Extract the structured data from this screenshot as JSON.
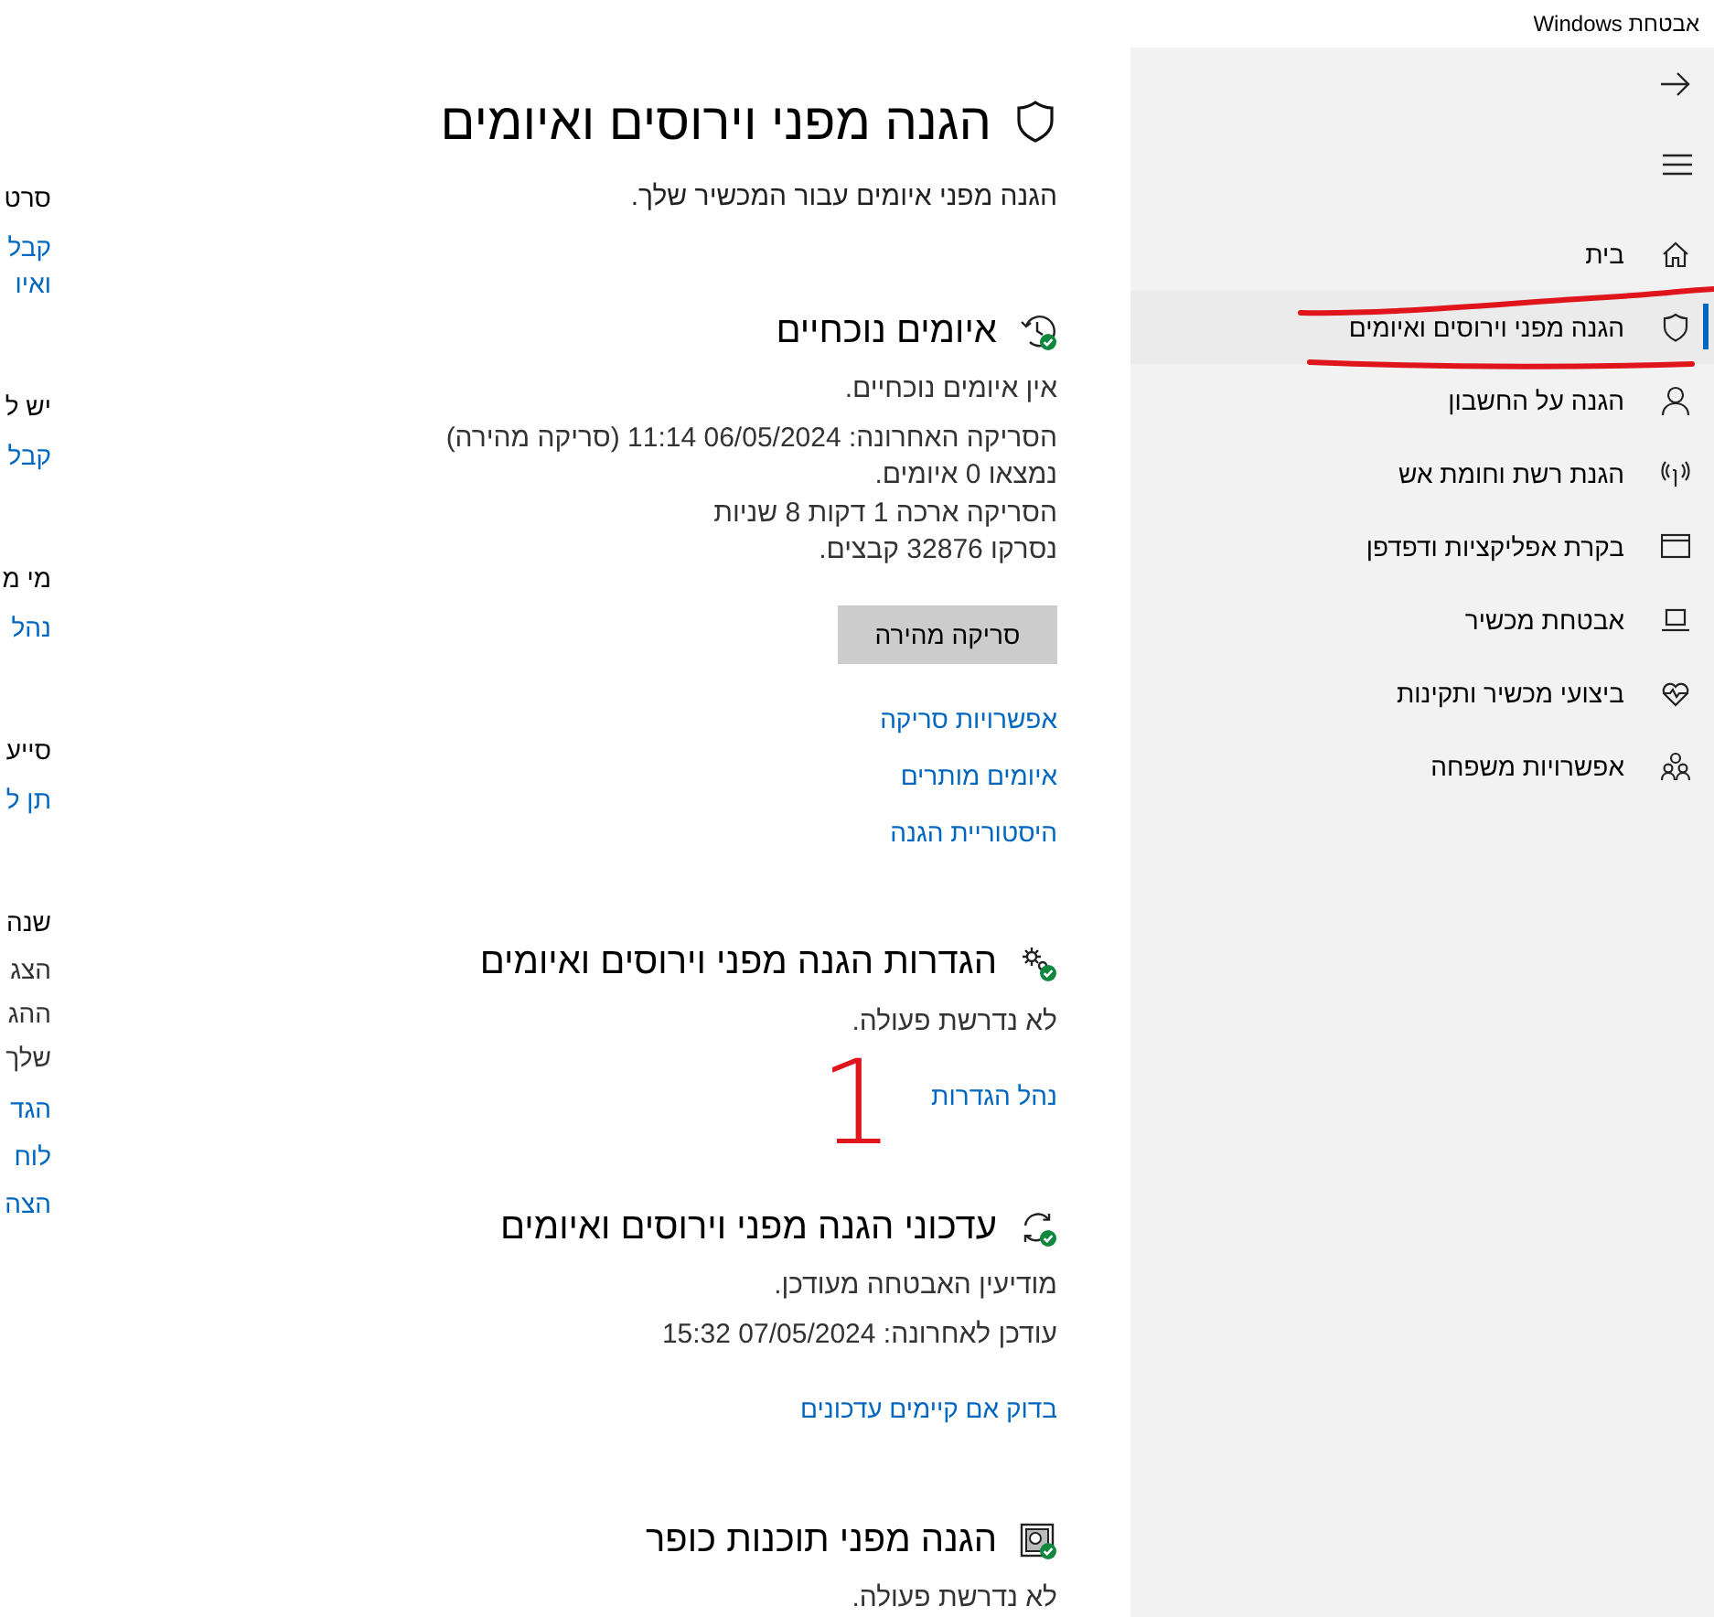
{
  "window": {
    "title": "אבטחת Windows"
  },
  "left_panel": [
    {
      "heading": "סרט",
      "links": [
        {
          "lines": [
            "קבל",
            "ואיו"
          ]
        }
      ]
    },
    {
      "heading": "יש ל",
      "links": [
        {
          "lines": [
            "קבל"
          ]
        }
      ]
    },
    {
      "heading": "מי מ",
      "links": [
        {
          "lines": [
            "נהל"
          ]
        }
      ]
    },
    {
      "heading": "סייע",
      "links": [
        {
          "lines": [
            "תן ל"
          ]
        }
      ]
    },
    {
      "heading": "שנה",
      "lines": [
        "הצג",
        "ההג",
        "שלך"
      ],
      "links": [
        {
          "lines": [
            "הגד"
          ]
        },
        {
          "lines": [
            "לוח"
          ]
        },
        {
          "lines": [
            "הצה"
          ]
        }
      ]
    }
  ],
  "page": {
    "title": "הגנה מפני וירוסים ואיומים",
    "subtitle": "הגנה מפני איומים עבור המכשיר שלך."
  },
  "sections": [
    {
      "heading": "איומים נוכחיים",
      "paragraphs": [
        [
          "אין איומים נוכחיים."
        ],
        [
          "הסריקה האחרונה: 06/05/2024 11:14 (סריקה מהירה)",
          "נמצאו 0 איומים.",
          "הסריקה ארכה 1 דקות 8 שניות",
          "נסרקו 32876 קבצים."
        ]
      ],
      "button": "סריקה מהירה",
      "links": [
        "אפשרויות סריקה",
        "איומים מותרים",
        "היסטוריית הגנה"
      ]
    },
    {
      "heading": "הגדרות הגנה מפני וירוסים ואיומים",
      "paragraphs": [
        [
          "לא נדרשת פעולה."
        ]
      ],
      "links": [
        "נהל הגדרות"
      ]
    },
    {
      "heading": "עדכוני הגנה מפני וירוסים ואיומים",
      "paragraphs": [
        [
          "מודיעין האבטחה מעודכן."
        ],
        [
          "עודכן לאחרונה: 07/05/2024 15:32"
        ]
      ],
      "links": [
        "בדוק אם קיימים עדכונים"
      ]
    },
    {
      "heading": "הגנה מפני תוכנות כופר",
      "paragraphs": [
        [
          "לא נדרשת פעולה."
        ]
      ]
    }
  ],
  "sidebar": {
    "items": [
      {
        "label": "בית",
        "selected": false
      },
      {
        "label": "הגנה מפני וירוסים ואיומים",
        "selected": true
      },
      {
        "label": "הגנה על החשבון",
        "selected": false
      },
      {
        "label": "הגנת רשת וחומת אש",
        "selected": false
      },
      {
        "label": "בקרת אפליקציות ודפדפן",
        "selected": false
      },
      {
        "label": "אבטחת מכשיר",
        "selected": false
      },
      {
        "label": "ביצועי מכשיר ותקינות",
        "selected": false
      },
      {
        "label": "אפשרויות משפחה",
        "selected": false
      }
    ]
  },
  "annotations": [
    {
      "kind": "stroke"
    },
    {
      "kind": "stroke"
    },
    {
      "kind": "note",
      "text": "1"
    }
  ]
}
